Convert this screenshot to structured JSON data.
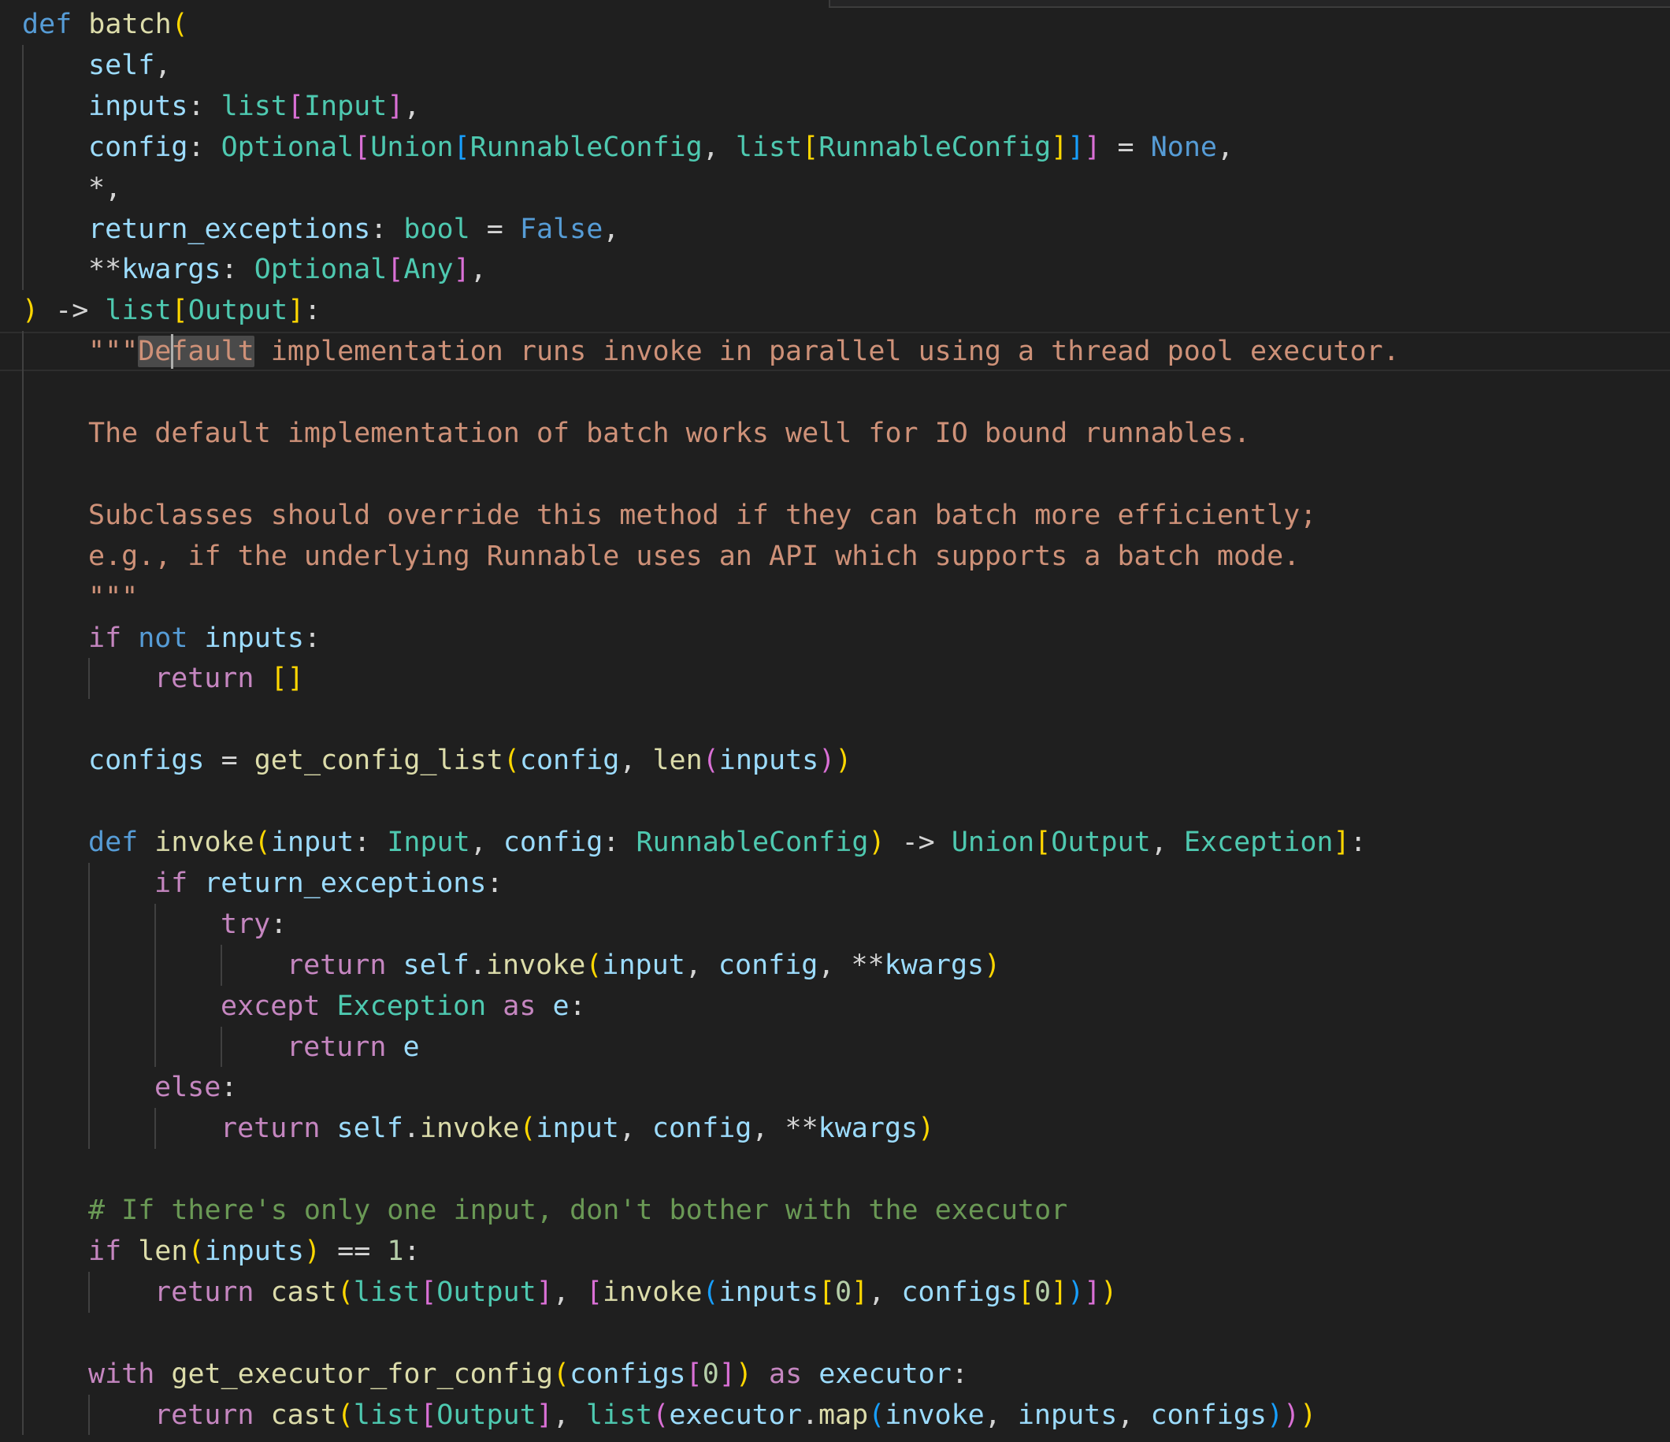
{
  "editor": {
    "language": "python",
    "cursor": {
      "line": 9,
      "column": 9
    },
    "theme_colors": {
      "background": "#1f1f1f",
      "keyword": "#569cd6",
      "control": "#c586c0",
      "function": "#dcdcaa",
      "variable": "#9cdcfe",
      "type": "#4ec9b0",
      "string": "#ce9178",
      "comment": "#6a9955",
      "bracket_1": "#ffd700",
      "bracket_2": "#da70d6",
      "bracket_3": "#179fff"
    },
    "lines": [
      {
        "indent": 0,
        "tokens": [
          [
            "kw",
            "def"
          ],
          [
            "pn",
            " "
          ],
          [
            "fn",
            "batch"
          ],
          [
            "b1",
            "("
          ]
        ]
      },
      {
        "indent": 1,
        "tokens": [
          [
            "var",
            "self"
          ],
          [
            "pn",
            ","
          ]
        ]
      },
      {
        "indent": 1,
        "tokens": [
          [
            "var",
            "inputs"
          ],
          [
            "pn",
            ": "
          ],
          [
            "type",
            "list"
          ],
          [
            "b2",
            "["
          ],
          [
            "type",
            "Input"
          ],
          [
            "b2",
            "]"
          ],
          [
            "pn",
            ","
          ]
        ]
      },
      {
        "indent": 1,
        "tokens": [
          [
            "var",
            "config"
          ],
          [
            "pn",
            ": "
          ],
          [
            "type",
            "Optional"
          ],
          [
            "b2",
            "["
          ],
          [
            "type",
            "Union"
          ],
          [
            "b3",
            "["
          ],
          [
            "type",
            "RunnableConfig"
          ],
          [
            "pn",
            ", "
          ],
          [
            "type",
            "list"
          ],
          [
            "b1",
            "["
          ],
          [
            "type",
            "RunnableConfig"
          ],
          [
            "b1",
            "]"
          ],
          [
            "b3",
            "]"
          ],
          [
            "b2",
            "]"
          ],
          [
            "pn",
            " = "
          ],
          [
            "kw",
            "None"
          ],
          [
            "pn",
            ","
          ]
        ]
      },
      {
        "indent": 1,
        "tokens": [
          [
            "pn",
            "*,"
          ]
        ]
      },
      {
        "indent": 1,
        "tokens": [
          [
            "var",
            "return_exceptions"
          ],
          [
            "pn",
            ": "
          ],
          [
            "type",
            "bool"
          ],
          [
            "pn",
            " = "
          ],
          [
            "kw",
            "False"
          ],
          [
            "pn",
            ","
          ]
        ]
      },
      {
        "indent": 1,
        "tokens": [
          [
            "pn",
            "**"
          ],
          [
            "var",
            "kwargs"
          ],
          [
            "pn",
            ": "
          ],
          [
            "type",
            "Optional"
          ],
          [
            "b2",
            "["
          ],
          [
            "type",
            "Any"
          ],
          [
            "b2",
            "]"
          ],
          [
            "pn",
            ","
          ]
        ]
      },
      {
        "indent": 0,
        "tokens": [
          [
            "b1",
            ")"
          ],
          [
            "pn",
            " -> "
          ],
          [
            "type",
            "list"
          ],
          [
            "b1",
            "["
          ],
          [
            "type",
            "Output"
          ],
          [
            "b1",
            "]"
          ],
          [
            "pn",
            ":"
          ]
        ]
      },
      {
        "indent": 1,
        "tokens": [
          [
            "str",
            "\"\"\""
          ],
          [
            "strhl",
            "Default"
          ],
          [
            "str",
            " implementation runs invoke in parallel using a thread pool executor."
          ]
        ]
      },
      {
        "indent": 0,
        "tokens": []
      },
      {
        "indent": 1,
        "tokens": [
          [
            "str",
            "The default implementation of batch works well for IO bound runnables."
          ]
        ]
      },
      {
        "indent": 0,
        "tokens": []
      },
      {
        "indent": 1,
        "tokens": [
          [
            "str",
            "Subclasses should override this method if they can batch more efficiently;"
          ]
        ]
      },
      {
        "indent": 1,
        "tokens": [
          [
            "str",
            "e.g., if the underlying Runnable uses an API which supports a batch mode."
          ]
        ]
      },
      {
        "indent": 1,
        "tokens": [
          [
            "str",
            "\"\"\""
          ]
        ]
      },
      {
        "indent": 1,
        "tokens": [
          [
            "ctl",
            "if"
          ],
          [
            "pn",
            " "
          ],
          [
            "kw",
            "not"
          ],
          [
            "pn",
            " "
          ],
          [
            "var",
            "inputs"
          ],
          [
            "pn",
            ":"
          ]
        ]
      },
      {
        "indent": 2,
        "tokens": [
          [
            "ctl",
            "return"
          ],
          [
            "pn",
            " "
          ],
          [
            "b1",
            "[]"
          ]
        ]
      },
      {
        "indent": 0,
        "tokens": []
      },
      {
        "indent": 1,
        "tokens": [
          [
            "var",
            "configs"
          ],
          [
            "pn",
            " = "
          ],
          [
            "fn",
            "get_config_list"
          ],
          [
            "b1",
            "("
          ],
          [
            "var",
            "config"
          ],
          [
            "pn",
            ", "
          ],
          [
            "fn",
            "len"
          ],
          [
            "b2",
            "("
          ],
          [
            "var",
            "inputs"
          ],
          [
            "b2",
            ")"
          ],
          [
            "b1",
            ")"
          ]
        ]
      },
      {
        "indent": 0,
        "tokens": []
      },
      {
        "indent": 1,
        "tokens": [
          [
            "kw",
            "def"
          ],
          [
            "pn",
            " "
          ],
          [
            "fn",
            "invoke"
          ],
          [
            "b1",
            "("
          ],
          [
            "var",
            "input"
          ],
          [
            "pn",
            ": "
          ],
          [
            "type",
            "Input"
          ],
          [
            "pn",
            ", "
          ],
          [
            "var",
            "config"
          ],
          [
            "pn",
            ": "
          ],
          [
            "type",
            "RunnableConfig"
          ],
          [
            "b1",
            ")"
          ],
          [
            "pn",
            " -> "
          ],
          [
            "type",
            "Union"
          ],
          [
            "b1",
            "["
          ],
          [
            "type",
            "Output"
          ],
          [
            "pn",
            ", "
          ],
          [
            "type",
            "Exception"
          ],
          [
            "b1",
            "]"
          ],
          [
            "pn",
            ":"
          ]
        ]
      },
      {
        "indent": 2,
        "tokens": [
          [
            "ctl",
            "if"
          ],
          [
            "pn",
            " "
          ],
          [
            "var",
            "return_exceptions"
          ],
          [
            "pn",
            ":"
          ]
        ]
      },
      {
        "indent": 3,
        "tokens": [
          [
            "ctl",
            "try"
          ],
          [
            "pn",
            ":"
          ]
        ]
      },
      {
        "indent": 4,
        "tokens": [
          [
            "ctl",
            "return"
          ],
          [
            "pn",
            " "
          ],
          [
            "var",
            "self"
          ],
          [
            "pn",
            "."
          ],
          [
            "fn",
            "invoke"
          ],
          [
            "b1",
            "("
          ],
          [
            "var",
            "input"
          ],
          [
            "pn",
            ", "
          ],
          [
            "var",
            "config"
          ],
          [
            "pn",
            ", **"
          ],
          [
            "var",
            "kwargs"
          ],
          [
            "b1",
            ")"
          ]
        ]
      },
      {
        "indent": 3,
        "tokens": [
          [
            "ctl",
            "except"
          ],
          [
            "pn",
            " "
          ],
          [
            "type",
            "Exception"
          ],
          [
            "pn",
            " "
          ],
          [
            "ctl",
            "as"
          ],
          [
            "pn",
            " "
          ],
          [
            "var",
            "e"
          ],
          [
            "pn",
            ":"
          ]
        ]
      },
      {
        "indent": 4,
        "tokens": [
          [
            "ctl",
            "return"
          ],
          [
            "pn",
            " "
          ],
          [
            "var",
            "e"
          ]
        ]
      },
      {
        "indent": 2,
        "tokens": [
          [
            "ctl",
            "else"
          ],
          [
            "pn",
            ":"
          ]
        ]
      },
      {
        "indent": 3,
        "tokens": [
          [
            "ctl",
            "return"
          ],
          [
            "pn",
            " "
          ],
          [
            "var",
            "self"
          ],
          [
            "pn",
            "."
          ],
          [
            "fn",
            "invoke"
          ],
          [
            "b1",
            "("
          ],
          [
            "var",
            "input"
          ],
          [
            "pn",
            ", "
          ],
          [
            "var",
            "config"
          ],
          [
            "pn",
            ", **"
          ],
          [
            "var",
            "kwargs"
          ],
          [
            "b1",
            ")"
          ]
        ]
      },
      {
        "indent": 0,
        "tokens": []
      },
      {
        "indent": 1,
        "tokens": [
          [
            "cm",
            "# If there's only one input, don't bother with the executor"
          ]
        ]
      },
      {
        "indent": 1,
        "tokens": [
          [
            "ctl",
            "if"
          ],
          [
            "pn",
            " "
          ],
          [
            "fn",
            "len"
          ],
          [
            "b1",
            "("
          ],
          [
            "var",
            "inputs"
          ],
          [
            "b1",
            ")"
          ],
          [
            "pn",
            " == "
          ],
          [
            "num",
            "1"
          ],
          [
            "pn",
            ":"
          ]
        ]
      },
      {
        "indent": 2,
        "tokens": [
          [
            "ctl",
            "return"
          ],
          [
            "pn",
            " "
          ],
          [
            "fn",
            "cast"
          ],
          [
            "b1",
            "("
          ],
          [
            "type",
            "list"
          ],
          [
            "b2",
            "["
          ],
          [
            "type",
            "Output"
          ],
          [
            "b2",
            "]"
          ],
          [
            "pn",
            ", "
          ],
          [
            "b2",
            "["
          ],
          [
            "fn",
            "invoke"
          ],
          [
            "b3",
            "("
          ],
          [
            "var",
            "inputs"
          ],
          [
            "b1",
            "["
          ],
          [
            "num",
            "0"
          ],
          [
            "b1",
            "]"
          ],
          [
            "pn",
            ", "
          ],
          [
            "var",
            "configs"
          ],
          [
            "b1",
            "["
          ],
          [
            "num",
            "0"
          ],
          [
            "b1",
            "]"
          ],
          [
            "b3",
            ")"
          ],
          [
            "b2",
            "]"
          ],
          [
            "b1",
            ")"
          ]
        ]
      },
      {
        "indent": 0,
        "tokens": []
      },
      {
        "indent": 1,
        "tokens": [
          [
            "ctl",
            "with"
          ],
          [
            "pn",
            " "
          ],
          [
            "fn",
            "get_executor_for_config"
          ],
          [
            "b1",
            "("
          ],
          [
            "var",
            "configs"
          ],
          [
            "b2",
            "["
          ],
          [
            "num",
            "0"
          ],
          [
            "b2",
            "]"
          ],
          [
            "b1",
            ")"
          ],
          [
            "pn",
            " "
          ],
          [
            "ctl",
            "as"
          ],
          [
            "pn",
            " "
          ],
          [
            "var",
            "executor"
          ],
          [
            "pn",
            ":"
          ]
        ]
      },
      {
        "indent": 2,
        "tokens": [
          [
            "ctl",
            "return"
          ],
          [
            "pn",
            " "
          ],
          [
            "fn",
            "cast"
          ],
          [
            "b1",
            "("
          ],
          [
            "type",
            "list"
          ],
          [
            "b2",
            "["
          ],
          [
            "type",
            "Output"
          ],
          [
            "b2",
            "]"
          ],
          [
            "pn",
            ", "
          ],
          [
            "type",
            "list"
          ],
          [
            "b2",
            "("
          ],
          [
            "var",
            "executor"
          ],
          [
            "pn",
            "."
          ],
          [
            "fn",
            "map"
          ],
          [
            "b3",
            "("
          ],
          [
            "var",
            "invoke"
          ],
          [
            "pn",
            ", "
          ],
          [
            "var",
            "inputs"
          ],
          [
            "pn",
            ", "
          ],
          [
            "var",
            "configs"
          ],
          [
            "b3",
            ")"
          ],
          [
            "b2",
            ")"
          ],
          [
            "b1",
            ")"
          ]
        ]
      }
    ]
  }
}
